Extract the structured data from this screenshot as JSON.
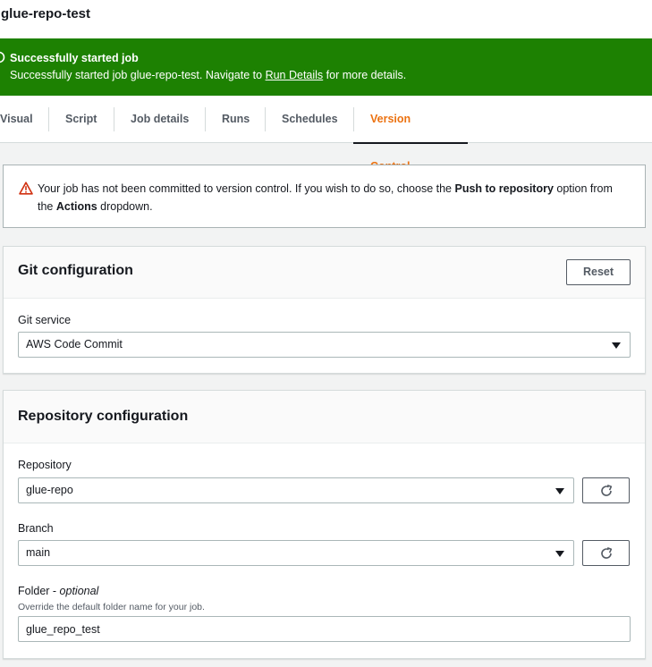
{
  "job": {
    "title": "glue-repo-test"
  },
  "flash": {
    "title": "Successfully started job",
    "message_prefix": "Successfully started job glue-repo-test. Navigate to ",
    "link": "Run Details",
    "message_suffix": " for more details."
  },
  "tabs": [
    {
      "label": "Visual"
    },
    {
      "label": "Script"
    },
    {
      "label": "Job details"
    },
    {
      "label": "Runs"
    },
    {
      "label": "Schedules"
    },
    {
      "label": "Version Control",
      "active": true
    }
  ],
  "alert": {
    "text1": "Your job has not been committed to version control. If you wish to do so, choose the ",
    "bold1": "Push to repository",
    "text2": " option from the ",
    "bold2": "Actions",
    "text3": " dropdown."
  },
  "git_config": {
    "title": "Git configuration",
    "reset_label": "Reset",
    "service_label": "Git service",
    "service_value": "AWS Code Commit"
  },
  "repo_config": {
    "title": "Repository configuration",
    "repository_label": "Repository",
    "repository_value": "glue-repo",
    "branch_label": "Branch",
    "branch_value": "main",
    "folder_label": "Folder - ",
    "folder_optional": "optional",
    "folder_description": "Override the default folder name for your job.",
    "folder_value": "glue_repo_test"
  },
  "colors": {
    "success": "#1d8102",
    "active_tab": "#ec7211",
    "warning": "#d13212"
  },
  "icons": [
    "success-icon",
    "warning-icon",
    "caret-down-icon",
    "refresh-icon"
  ]
}
